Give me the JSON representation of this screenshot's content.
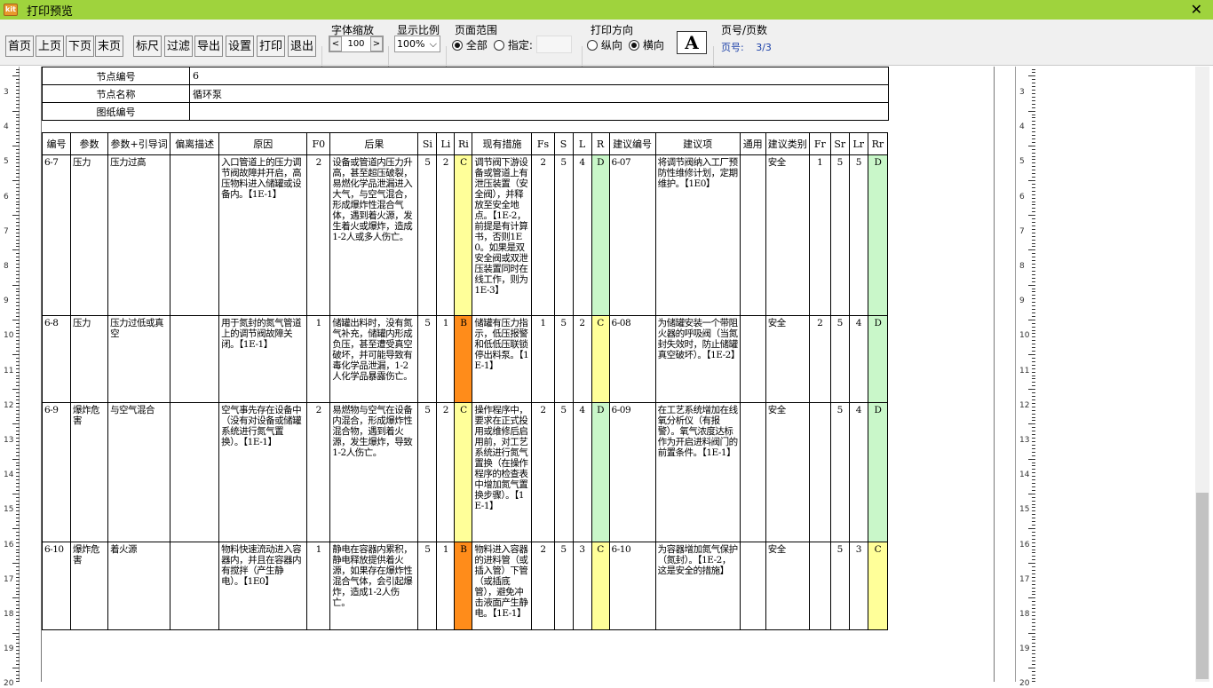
{
  "window": {
    "title": "打印预览"
  },
  "toolbar": {
    "buttons": [
      "首页",
      "上页",
      "下页",
      "末页",
      "标尺",
      "过滤",
      "导出",
      "设置",
      "打印",
      "退出"
    ],
    "font_zoom": {
      "label": "字体缩放",
      "value": "100",
      "dec": "<",
      "inc": ">"
    },
    "display_ratio": {
      "label": "显示比例",
      "value": "100%"
    },
    "page_range": {
      "label": "页面范围",
      "all": "全部",
      "specified": "指定:",
      "specified_value": ""
    },
    "orientation": {
      "label": "打印方向",
      "portrait": "纵向",
      "landscape": "横向"
    },
    "font_icon": "A",
    "page_count": {
      "label": "页号/页数",
      "page_label": "页号:",
      "value": "3/3"
    }
  },
  "ruler": {
    "left": [
      "3",
      "4",
      "5",
      "6",
      "7",
      "8",
      "9",
      "10",
      "11",
      "12",
      "13",
      "14",
      "15",
      "16",
      "17",
      "18",
      "19",
      "20"
    ],
    "right": [
      "3",
      "4",
      "5",
      "6",
      "7",
      "8",
      "9",
      "10",
      "11",
      "12",
      "13",
      "14",
      "15",
      "16",
      "17",
      "18",
      "19",
      "20"
    ]
  },
  "meta": {
    "rows": [
      {
        "key": "节点编号",
        "value": "6"
      },
      {
        "key": "节点名称",
        "value": "循环泵"
      },
      {
        "key": "图纸编号",
        "value": ""
      }
    ]
  },
  "table": {
    "headers": [
      "编号",
      "参数",
      "参数+引导词",
      "偏离描述",
      "原因",
      "F0",
      "后果",
      "Si",
      "Li",
      "Ri",
      "现有措施",
      "Fs",
      "S",
      "L",
      "R",
      "建议编号",
      "建议项",
      "通用",
      "建议类别",
      "Fr",
      "Sr",
      "Lr",
      "Rr"
    ],
    "rows": [
      {
        "id": "6-7",
        "param": "压力",
        "guide": "压力过高",
        "dev": "",
        "cause": "入口管道上的压力调节阀故障并开启，高压物料进入储罐或设备内。【1E-1】",
        "f0": "2",
        "conseq": "设备或管道内压力升高，甚至超压破裂，易燃化学品泄漏进入大气，与空气混合，形成爆炸性混合气体，遇到着火源，发生着火或爆炸，造成1-2人或多人伤亡。",
        "si": "5",
        "li": "2",
        "ri": "C",
        "measure": "调节阀下游设备或管道上有泄压装置（安全阀），并释放至安全地点。【1E-2，前提是有计算书，否则1E0。如果是双安全阀或双泄压装置同时在线工作，则为1E-3】",
        "fs": "2",
        "s": "5",
        "l": "4",
        "r": "D",
        "sug_id": "6-07",
        "sug": "将调节阀纳入工厂预防性维修计划，定期维护。【1E0】",
        "common": "",
        "cat": "安全",
        "fr": "1",
        "sr": "5",
        "lr": "5",
        "rr": "D"
      },
      {
        "id": "6-8",
        "param": "压力",
        "guide": "压力过低或真空",
        "dev": "",
        "cause": "用于氮封的氮气管道上的调节阀故障关闭。【1E-1】",
        "f0": "1",
        "conseq": "储罐出料时，没有氮气补充，储罐内形成负压，甚至遭受真空破坏，并可能导致有毒化学品泄漏，1-2人化学品暴露伤亡。",
        "si": "5",
        "li": "1",
        "ri": "B",
        "measure": "储罐有压力指示，低压报警和低低压联锁停出料泵。【1E-1】",
        "fs": "1",
        "s": "5",
        "l": "2",
        "r": "C",
        "sug_id": "6-08",
        "sug": "为储罐安装一个带阻火器的呼吸阀（当氮封失效时，防止储罐真空破坏）。【1E-2】",
        "common": "",
        "cat": "安全",
        "fr": "2",
        "sr": "5",
        "lr": "4",
        "rr": "D"
      },
      {
        "id": "6-9",
        "param": "爆炸危害",
        "guide": "与空气混合",
        "dev": "",
        "cause": "空气事先存在设备中（没有对设备或储罐系统进行氮气置换）。【1E-1】",
        "f0": "2",
        "conseq": "易燃物与空气在设备内混合，形成爆炸性混合物，遇到着火源，发生爆炸，导致1-2人伤亡。",
        "si": "5",
        "li": "2",
        "ri": "C",
        "measure": "操作程序中，要求在正式投用或维修后启用前，对工艺系统进行氮气置换（在操作程序的检查表中增加氮气置换步骤）。【1E-1】",
        "fs": "2",
        "s": "5",
        "l": "4",
        "r": "D",
        "sug_id": "6-09",
        "sug": "在工艺系统增加在线氧分析仪（有报警）。氧气浓度达标作为开启进料阀门的前置条件。【1E-1】",
        "common": "",
        "cat": "安全",
        "fr": "",
        "sr": "5",
        "lr": "4",
        "rr": "D"
      },
      {
        "id": "6-10",
        "param": "爆炸危害",
        "guide": "着火源",
        "dev": "",
        "cause": "物料快速流动进入容器内，并且在容器内有搅拌（产生静电）。【1E0】",
        "f0": "1",
        "conseq": "静电在容器内累积，静电释放提供着火源，如果存在爆炸性混合气体，会引起爆炸，造成1-2人伤亡。",
        "si": "5",
        "li": "1",
        "ri": "B",
        "measure": "物料进入容器的进料管（或插入管）下管（或插底管），避免冲击液面产生静电。【1E-1】",
        "fs": "2",
        "s": "5",
        "l": "3",
        "r": "C",
        "sug_id": "6-10",
        "sug": "为容器增加氮气保护（氮封）。【1E-2，这是安全的措施】",
        "common": "",
        "cat": "安全",
        "fr": "",
        "sr": "5",
        "lr": "3",
        "rr": "C"
      }
    ]
  },
  "colors": {
    "titlebar": "#9fd33d",
    "risk_B": "#ff8c1a",
    "risk_C": "#ffff99",
    "risk_D": "#c9f7c9",
    "page_label": "#1a3fa8"
  }
}
